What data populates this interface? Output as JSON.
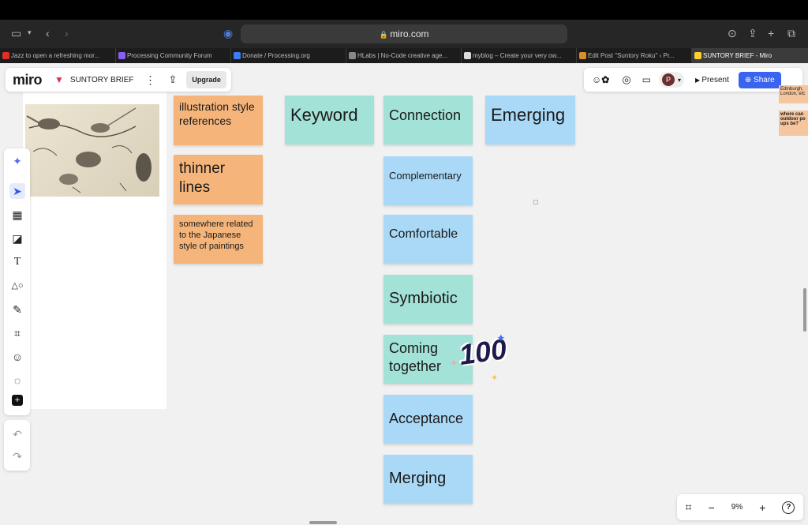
{
  "browser": {
    "url": "miro.com",
    "tabs": [
      {
        "label": "Jazz to open a refreshing mor...",
        "color": "#e52d27"
      },
      {
        "label": "Processing Community Forum",
        "color": "#8a5cf6"
      },
      {
        "label": "Donate / Processing.org",
        "color": "#3d7cf5"
      },
      {
        "label": "HLabs | No-Code creative age...",
        "color": "#888888"
      },
      {
        "label": "myblog – Create your very ow...",
        "color": "#dddddd"
      },
      {
        "label": "Edit Post \"Suntory Roku\" ‹ Pr...",
        "color": "#d98e2b"
      },
      {
        "label": "SUNTORY BRIEF - Miro",
        "color": "#ffd02f"
      }
    ]
  },
  "board": {
    "logo": "miro",
    "title": "SUNTORY BRIEF",
    "upgrade": "Upgrade",
    "present": "Present",
    "share": "Share",
    "avatar": "P",
    "zoom": "9%"
  },
  "notes": {
    "n1": "illustration style references",
    "n2": "thinner lines",
    "n3": "somewhere related to the Japanese style of paintings",
    "keyword": "Keyword",
    "connection": "Connection",
    "emerging": "Emerging",
    "complementary": "Complementary",
    "comfortable": "Comfortable",
    "symbiotic": "Symbiotic",
    "coming": "Coming together",
    "acceptance": "Acceptance",
    "merging": "Merging"
  },
  "edge_notes": {
    "e1": "Edinburgh, London, etc",
    "e2": "where can outdoor po ups be?"
  },
  "sticker": "100"
}
